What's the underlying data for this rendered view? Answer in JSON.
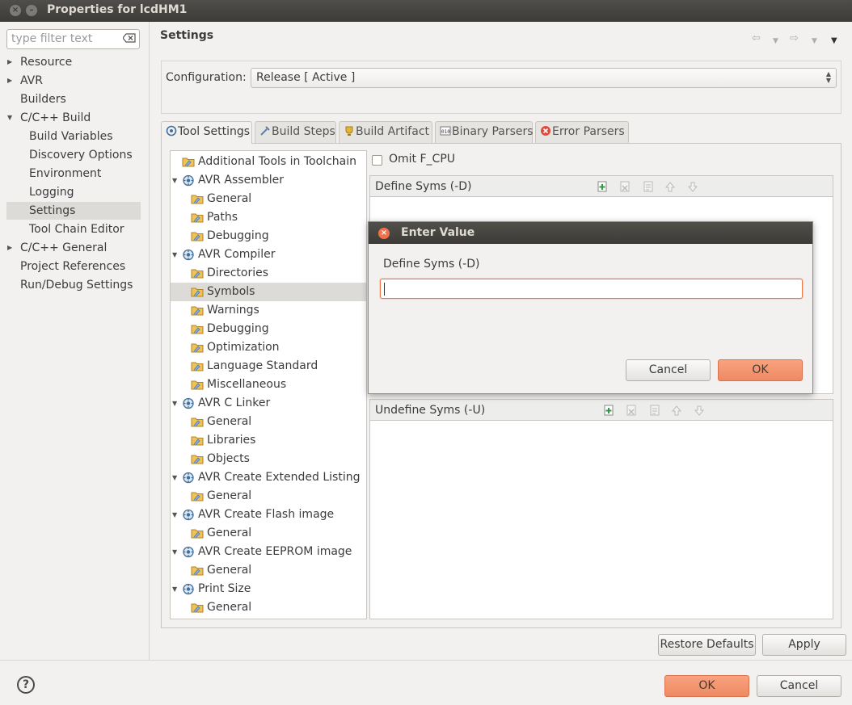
{
  "window": {
    "title": "Properties for lcdHM1"
  },
  "sidebar": {
    "filter_placeholder": "type filter text",
    "items": [
      {
        "label": "Resource",
        "expandable": true,
        "level": 0
      },
      {
        "label": "AVR",
        "expandable": true,
        "level": 0
      },
      {
        "label": "Builders",
        "expandable": false,
        "level": 0
      },
      {
        "label": "C/C++ Build",
        "expandable": true,
        "expanded": true,
        "level": 0
      },
      {
        "label": "Build Variables",
        "level": 1
      },
      {
        "label": "Discovery Options",
        "level": 1
      },
      {
        "label": "Environment",
        "level": 1
      },
      {
        "label": "Logging",
        "level": 1
      },
      {
        "label": "Settings",
        "level": 1,
        "selected": true
      },
      {
        "label": "Tool Chain Editor",
        "level": 1
      },
      {
        "label": "C/C++ General",
        "expandable": true,
        "level": 0
      },
      {
        "label": "Project References",
        "level": 0
      },
      {
        "label": "Run/Debug Settings",
        "level": 0
      }
    ]
  },
  "header": {
    "title": "Settings"
  },
  "configuration": {
    "label": "Configuration:",
    "value": "Release  [ Active ]"
  },
  "tabs": [
    {
      "label": "Tool Settings",
      "icon": "tool-settings-icon",
      "active": true
    },
    {
      "label": "Build Steps",
      "icon": "build-steps-icon"
    },
    {
      "label": "Build Artifact",
      "icon": "build-artifact-icon"
    },
    {
      "label": "Binary Parsers",
      "icon": "binary-parsers-icon"
    },
    {
      "label": "Error Parsers",
      "icon": "error-parsers-icon"
    }
  ],
  "tool_tree": [
    {
      "label": "Additional Tools in Toolchain",
      "level": 0,
      "type": "folder"
    },
    {
      "label": "AVR Assembler",
      "level": 0,
      "type": "tool",
      "expanded": true
    },
    {
      "label": "General",
      "level": 1,
      "type": "folder"
    },
    {
      "label": "Paths",
      "level": 1,
      "type": "folder"
    },
    {
      "label": "Debugging",
      "level": 1,
      "type": "folder"
    },
    {
      "label": "AVR Compiler",
      "level": 0,
      "type": "tool",
      "expanded": true
    },
    {
      "label": "Directories",
      "level": 1,
      "type": "folder"
    },
    {
      "label": "Symbols",
      "level": 1,
      "type": "folder",
      "selected": true
    },
    {
      "label": "Warnings",
      "level": 1,
      "type": "folder"
    },
    {
      "label": "Debugging",
      "level": 1,
      "type": "folder"
    },
    {
      "label": "Optimization",
      "level": 1,
      "type": "folder"
    },
    {
      "label": "Language Standard",
      "level": 1,
      "type": "folder"
    },
    {
      "label": "Miscellaneous",
      "level": 1,
      "type": "folder"
    },
    {
      "label": "AVR C Linker",
      "level": 0,
      "type": "tool",
      "expanded": true
    },
    {
      "label": "General",
      "level": 1,
      "type": "folder"
    },
    {
      "label": "Libraries",
      "level": 1,
      "type": "folder"
    },
    {
      "label": "Objects",
      "level": 1,
      "type": "folder"
    },
    {
      "label": "AVR Create Extended Listing",
      "level": 0,
      "type": "tool",
      "expanded": true
    },
    {
      "label": "General",
      "level": 1,
      "type": "folder"
    },
    {
      "label": "AVR Create Flash image",
      "level": 0,
      "type": "tool",
      "expanded": true
    },
    {
      "label": "General",
      "level": 1,
      "type": "folder"
    },
    {
      "label": "AVR Create EEPROM image",
      "level": 0,
      "type": "tool",
      "expanded": true
    },
    {
      "label": "General",
      "level": 1,
      "type": "folder"
    },
    {
      "label": "Print Size",
      "level": 0,
      "type": "tool",
      "expanded": true
    },
    {
      "label": "General",
      "level": 1,
      "type": "folder"
    }
  ],
  "options": {
    "omit_fcpu_label": "Omit F_CPU",
    "omit_fcpu_checked": false,
    "define_syms_label": "Define Syms (-D)",
    "undefine_syms_label": "Undefine Syms (-U)"
  },
  "dialog": {
    "title": "Enter Value",
    "field_label": "Define Syms (-D)",
    "field_value": "",
    "cancel_label": "Cancel",
    "ok_label": "OK"
  },
  "panel_buttons": {
    "restore_defaults": "Restore Defaults",
    "apply": "Apply"
  },
  "footer": {
    "ok": "OK",
    "cancel": "Cancel",
    "help_icon_text": "?"
  },
  "colors": {
    "accent": "#f0714a",
    "primary_button": "#ee8a63",
    "titlebar": "#3c3b37",
    "selection": "#dcdbd8"
  }
}
